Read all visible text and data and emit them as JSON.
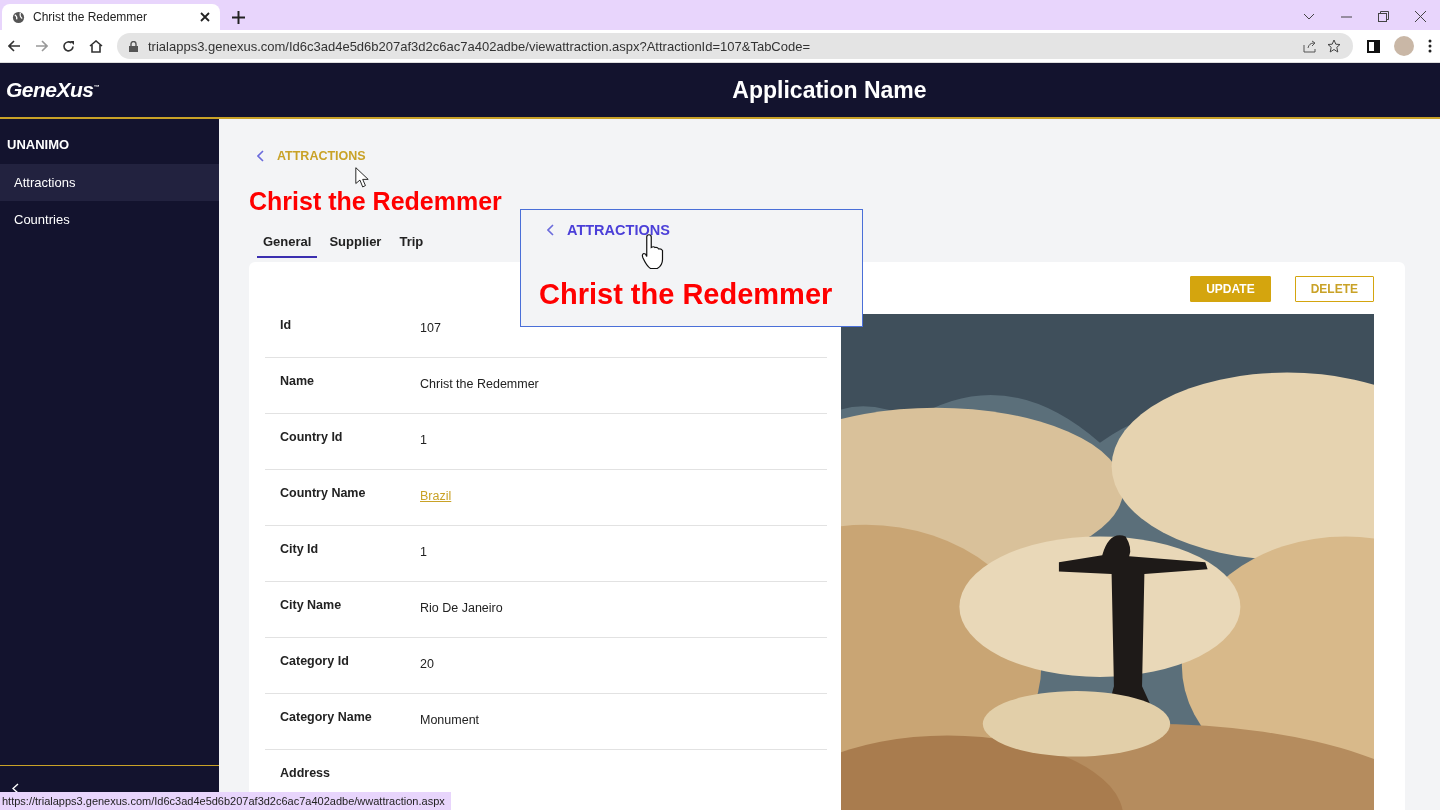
{
  "browser": {
    "tab_title": "Christ the Redemmer",
    "url": "trialapps3.genexus.com/Id6c3ad4e5d6b207af3d2c6ac7a402adbe/viewattraction.aspx?AttractionId=107&TabCode=",
    "status_url": "https://trialapps3.genexus.com/Id6c3ad4e5d6b207af3d2c6ac7a402adbe/wwattraction.aspx"
  },
  "header": {
    "logo": "GeneXus$^{™}$",
    "title": "Application Name"
  },
  "sidebar": {
    "heading": "UNANIMO",
    "items": [
      {
        "label": "Attractions",
        "selected": true
      },
      {
        "label": "Countries",
        "selected": false
      }
    ]
  },
  "breadcrumb": "ATTRACTIONS",
  "title": "Christ the Redemmer",
  "tabs": [
    {
      "label": "General",
      "selected": true
    },
    {
      "label": "Supplier",
      "selected": false
    },
    {
      "label": "Trip",
      "selected": false
    }
  ],
  "actions": [
    {
      "label": "UPDATE",
      "kind": "primary"
    },
    {
      "label": "DELETE",
      "kind": "outline"
    }
  ],
  "fields": [
    {
      "label": "Id",
      "value": "107"
    },
    {
      "label": "Name",
      "value": "Christ the Redemmer"
    },
    {
      "label": "Country Id",
      "value": "1"
    },
    {
      "label": "Country Name",
      "value": "Brazil",
      "kind": "link"
    },
    {
      "label": "City Id",
      "value": "1"
    },
    {
      "label": "City Name",
      "value": "Rio De Janeiro"
    },
    {
      "label": "Category Id",
      "value": "20"
    },
    {
      "label": "Category Name",
      "value": "Monument"
    },
    {
      "label": "Address"
    }
  ],
  "callout": {
    "breadcrumb": "ATTRACTIONS",
    "title": "Christ the Redemmer"
  }
}
